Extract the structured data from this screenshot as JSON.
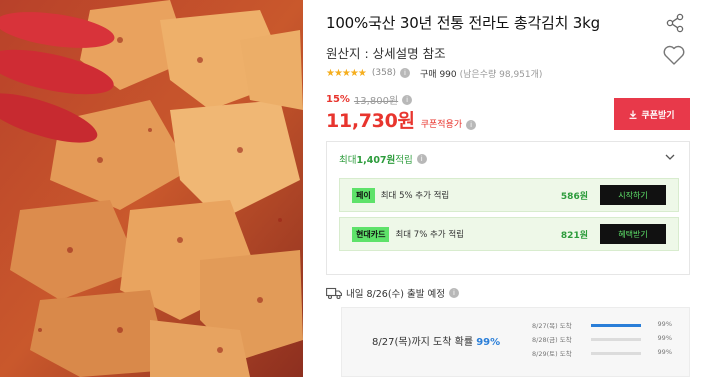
{
  "product": {
    "title": "100%국산 30년 전통 전라도 총각김치 3kg",
    "origin": "원산지 : 상세설명 참조",
    "rating": {
      "stars": 4.5,
      "stars_text": "★★★★★",
      "review_count": "(358)",
      "purchase_count": "구매 990",
      "remaining": "(남은수량 98,951개)"
    },
    "price": {
      "discount_rate": "15%",
      "original_price": "13,800원",
      "sale_price": "11,730원",
      "coupon_applied": "쿠폰적용가"
    },
    "coupon_button": "쿠폰받기"
  },
  "points": {
    "header_prefix": "최대 ",
    "header_amount": "1,407원",
    "header_suffix": " 적립",
    "benefits": [
      {
        "badge": "페이",
        "text": "최대 5% 추가 적립",
        "amount": "586원",
        "button": "시작하기"
      },
      {
        "badge": "현대카드",
        "text": "최대 7% 추가 적립",
        "amount": "821원",
        "button": "혜택받기"
      }
    ]
  },
  "shipping": {
    "text": "내일 8/26(수) 출발 예정",
    "prob_prefix": "8/27(목)까지 도착 확률 ",
    "prob_value": "99%",
    "distribution": [
      {
        "label": "8/27(목) 도착",
        "percent": 99,
        "percent_text": "99%",
        "fill": 1.0
      },
      {
        "label": "8/28(금) 도착",
        "percent": 99,
        "percent_text": "99%",
        "fill": 0.0
      },
      {
        "label": "8/29(토) 도착",
        "percent": 99,
        "percent_text": "99%",
        "fill": 0.0
      }
    ]
  },
  "colors": {
    "accent_red": "#e8352e",
    "coupon_button": "#e8394a",
    "green": "#2d9c3c",
    "blue": "#2a7ed8"
  },
  "icons": {
    "share": "share-icon",
    "heart": "heart-icon",
    "info": "info-icon",
    "chevron": "chevron-down-icon",
    "truck": "truck-icon",
    "download": "download-icon"
  }
}
